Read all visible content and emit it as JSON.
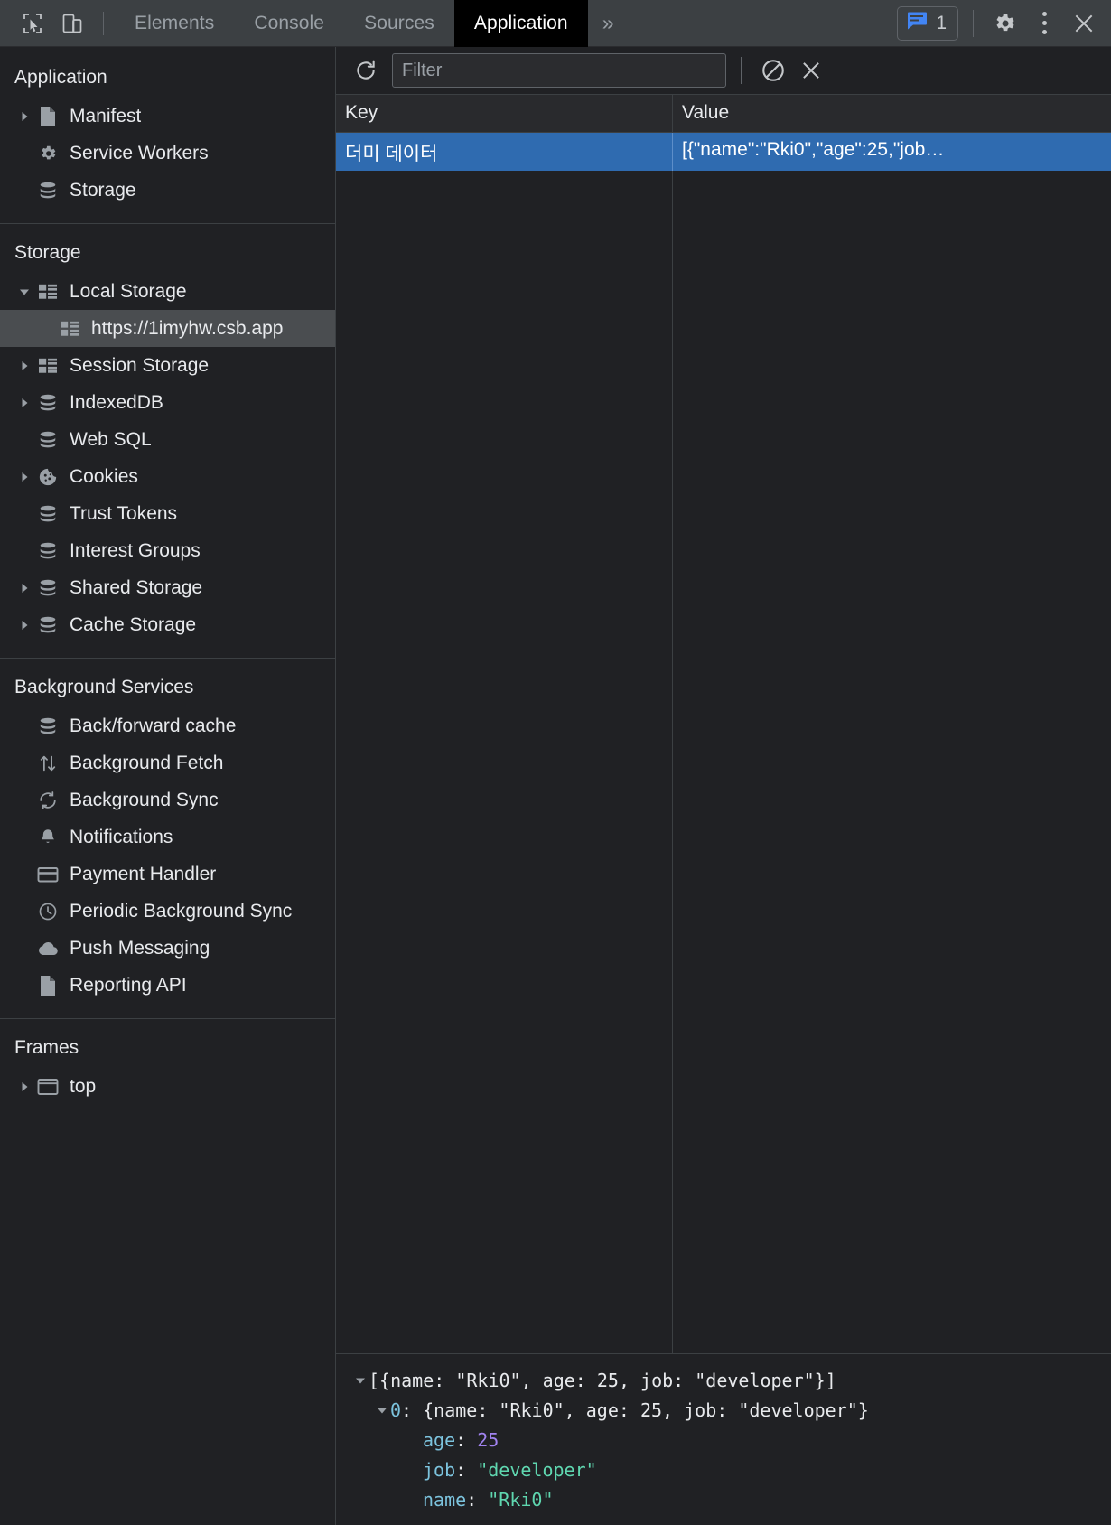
{
  "tabbar": {
    "inspect_icon": "cursor-select-icon",
    "device_icon": "device-toolbar-icon",
    "tabs": [
      {
        "label": "Elements",
        "active": false
      },
      {
        "label": "Console",
        "active": false
      },
      {
        "label": "Sources",
        "active": false
      },
      {
        "label": "Application",
        "active": true
      }
    ],
    "more_label": "»",
    "issues_count": "1",
    "issues_icon": "issues-message-icon",
    "settings_icon": "gear-icon",
    "menu_icon": "kebab-menu-icon",
    "close_icon": "close-icon"
  },
  "sidebar": {
    "sections": [
      {
        "title": "Application",
        "items": [
          {
            "label": "Manifest",
            "icon": "manifest-file-icon",
            "twisty": "collapsed",
            "indent": 1,
            "selected": false
          },
          {
            "label": "Service Workers",
            "icon": "gear-icon",
            "twisty": "none",
            "indent": 1,
            "selected": false
          },
          {
            "label": "Storage",
            "icon": "database-icon",
            "twisty": "none",
            "indent": 1,
            "selected": false
          }
        ]
      },
      {
        "title": "Storage",
        "items": [
          {
            "label": "Local Storage",
            "icon": "table-grid-icon",
            "twisty": "expanded",
            "indent": 1,
            "selected": false
          },
          {
            "label": "https://1imyhw.csb.app",
            "icon": "table-grid-icon",
            "twisty": "none",
            "indent": 2,
            "selected": true
          },
          {
            "label": "Session Storage",
            "icon": "table-grid-icon",
            "twisty": "collapsed",
            "indent": 1,
            "selected": false
          },
          {
            "label": "IndexedDB",
            "icon": "database-icon",
            "twisty": "collapsed",
            "indent": 1,
            "selected": false
          },
          {
            "label": "Web SQL",
            "icon": "database-icon",
            "twisty": "none",
            "indent": 1,
            "selected": false
          },
          {
            "label": "Cookies",
            "icon": "cookie-icon",
            "twisty": "collapsed",
            "indent": 1,
            "selected": false
          },
          {
            "label": "Trust Tokens",
            "icon": "database-icon",
            "twisty": "none",
            "indent": 1,
            "selected": false
          },
          {
            "label": "Interest Groups",
            "icon": "database-icon",
            "twisty": "none",
            "indent": 1,
            "selected": false
          },
          {
            "label": "Shared Storage",
            "icon": "database-icon",
            "twisty": "collapsed",
            "indent": 1,
            "selected": false
          },
          {
            "label": "Cache Storage",
            "icon": "database-icon",
            "twisty": "collapsed",
            "indent": 1,
            "selected": false
          }
        ]
      },
      {
        "title": "Background Services",
        "items": [
          {
            "label": "Back/forward cache",
            "icon": "database-icon",
            "twisty": "none",
            "indent": 1,
            "selected": false
          },
          {
            "label": "Background Fetch",
            "icon": "arrows-updown-icon",
            "twisty": "none",
            "indent": 1,
            "selected": false
          },
          {
            "label": "Background Sync",
            "icon": "sync-refresh-icon",
            "twisty": "none",
            "indent": 1,
            "selected": false
          },
          {
            "label": "Notifications",
            "icon": "bell-icon",
            "twisty": "none",
            "indent": 1,
            "selected": false
          },
          {
            "label": "Payment Handler",
            "icon": "credit-card-icon",
            "twisty": "none",
            "indent": 1,
            "selected": false
          },
          {
            "label": "Periodic Background Sync",
            "icon": "clock-icon",
            "twisty": "none",
            "indent": 1,
            "selected": false
          },
          {
            "label": "Push Messaging",
            "icon": "cloud-icon",
            "twisty": "none",
            "indent": 1,
            "selected": false
          },
          {
            "label": "Reporting API",
            "icon": "document-icon",
            "twisty": "none",
            "indent": 1,
            "selected": false
          }
        ]
      },
      {
        "title": "Frames",
        "items": [
          {
            "label": "top",
            "icon": "frame-window-icon",
            "twisty": "collapsed",
            "indent": 1,
            "selected": false
          }
        ]
      }
    ]
  },
  "toolbar": {
    "refresh_icon": "refresh-icon",
    "filter_placeholder": "Filter",
    "filter_value": "",
    "clear_all_icon": "clear-all-no-entry-icon",
    "delete_icon": "delete-x-icon"
  },
  "grid": {
    "columns": [
      "Key",
      "Value"
    ],
    "rows": [
      {
        "key": "더미 데이터",
        "value": "[{\"name\":\"Rki0\",\"age\":25,\"job…",
        "selected": true
      }
    ]
  },
  "preview": {
    "lines": [
      {
        "indent": 0,
        "twisty": "expanded",
        "segments": [
          {
            "text": "[{name: \"Rki0\", age: 25, job: \"developer\"}]",
            "type": "plain"
          }
        ]
      },
      {
        "indent": 1,
        "twisty": "expanded",
        "segments": [
          {
            "text": "0",
            "type": "index"
          },
          {
            "text": ": {name: \"Rki0\", age: 25, job: \"developer\"}",
            "type": "plain"
          }
        ]
      },
      {
        "indent": 2,
        "twisty": "none",
        "segments": [
          {
            "text": "age",
            "type": "prop"
          },
          {
            "text": ": ",
            "type": "plain"
          },
          {
            "text": "25",
            "type": "number"
          }
        ]
      },
      {
        "indent": 2,
        "twisty": "none",
        "segments": [
          {
            "text": "job",
            "type": "prop"
          },
          {
            "text": ": ",
            "type": "plain"
          },
          {
            "text": "\"developer\"",
            "type": "string"
          }
        ]
      },
      {
        "indent": 2,
        "twisty": "none",
        "segments": [
          {
            "text": "name",
            "type": "prop"
          },
          {
            "text": ": ",
            "type": "plain"
          },
          {
            "text": "\"Rki0\"",
            "type": "string"
          }
        ]
      }
    ]
  },
  "colors": {
    "selection_blue": "#2f6bb0",
    "accent_blue": "#4285f4",
    "panel_bg": "#202124",
    "tabbar_bg": "#3c4043",
    "prop_blue": "#7cc3dd",
    "number_purple": "#a183f0",
    "string_green": "#5fd7b0"
  }
}
